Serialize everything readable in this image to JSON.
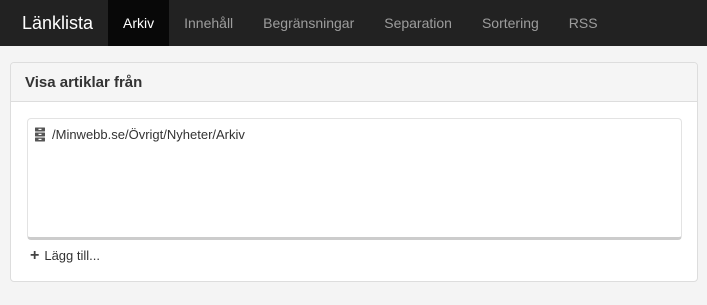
{
  "header": {
    "brand": "Länklista",
    "tabs": [
      {
        "label": "Arkiv",
        "active": true
      },
      {
        "label": "Innehåll",
        "active": false
      },
      {
        "label": "Begränsningar",
        "active": false
      },
      {
        "label": "Separation",
        "active": false
      },
      {
        "label": "Sortering",
        "active": false
      },
      {
        "label": "RSS",
        "active": false
      }
    ]
  },
  "panel": {
    "title": "Visa artiklar från",
    "items": [
      {
        "path": "/Minwebb.se/Övrigt/Nyheter/Arkiv",
        "icon": "archive-icon"
      }
    ],
    "add_label": "Lägg till..."
  },
  "colors": {
    "topbar": "#222222",
    "active_tab": "#080808",
    "inactive_tab_text": "#9d9d9d"
  }
}
